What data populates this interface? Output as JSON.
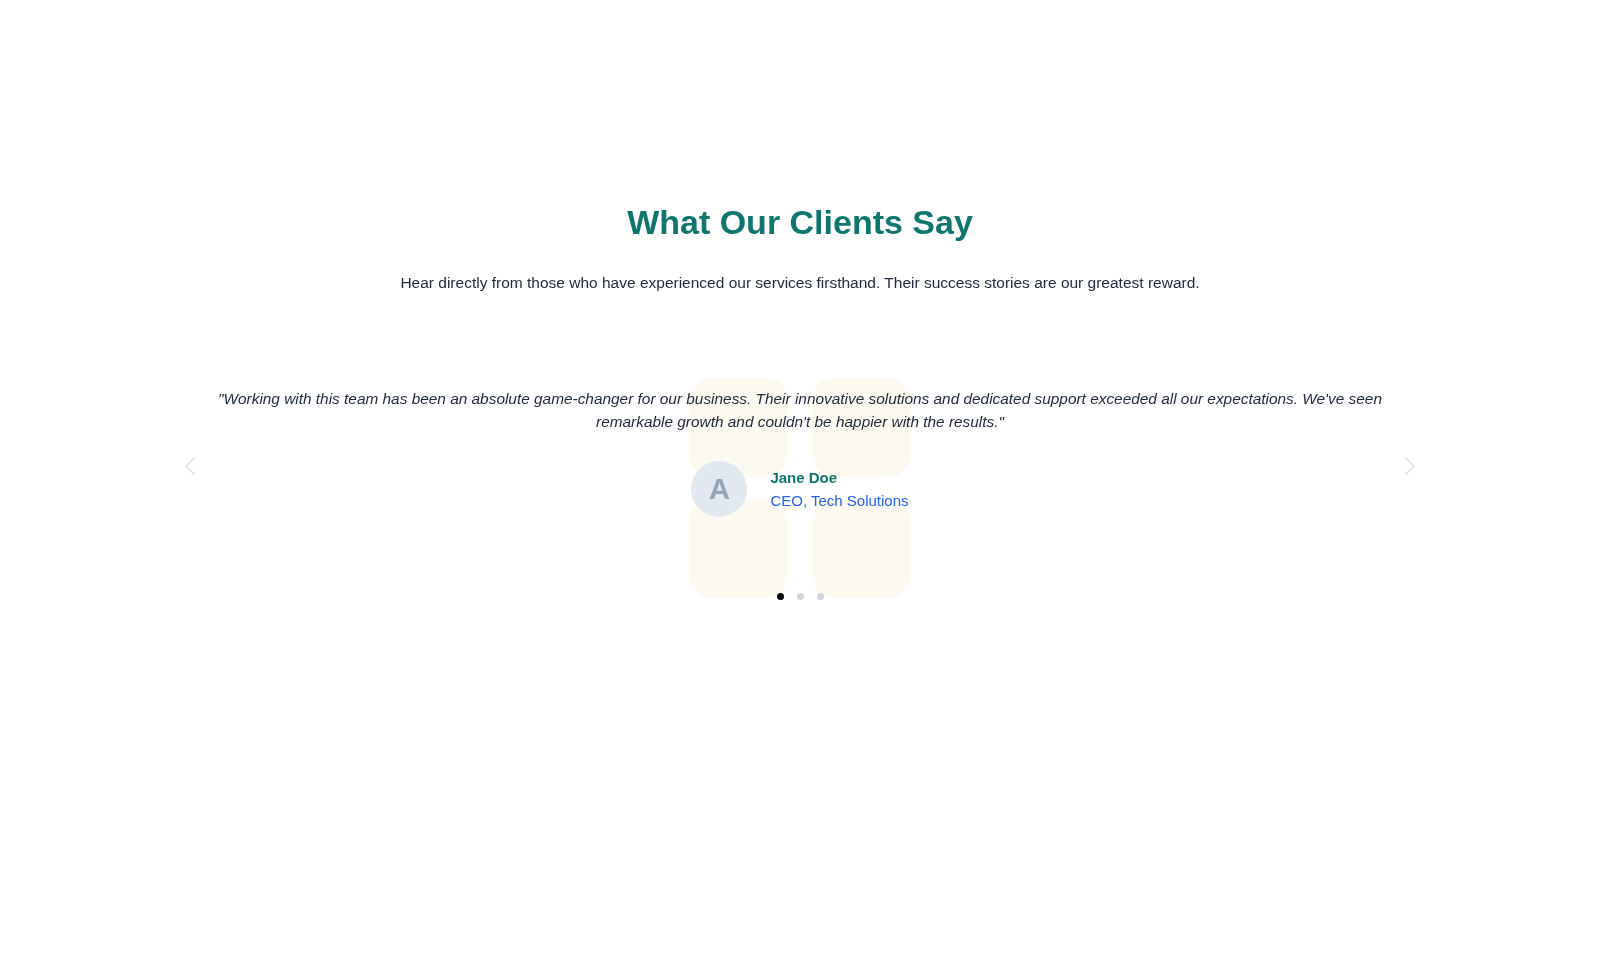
{
  "section": {
    "heading": "What Our Clients Say",
    "subtitle": "Hear directly from those who have experienced our services firsthand. Their success stories are our greatest reward."
  },
  "carousel": {
    "testimonials": [
      {
        "quote": "\"Working with this team has been an absolute game-changer for our business. Their innovative solutions and dedicated support exceeded all our expectations. We've seen remarkable growth and couldn't be happier with the results.\"",
        "avatar": {
          "initial": "A"
        },
        "name": "Jane Doe",
        "role": "CEO, Tech Solutions"
      }
    ],
    "pagination": [
      {
        "selected": true
      },
      {
        "selected": false
      },
      {
        "selected": false
      }
    ]
  }
}
